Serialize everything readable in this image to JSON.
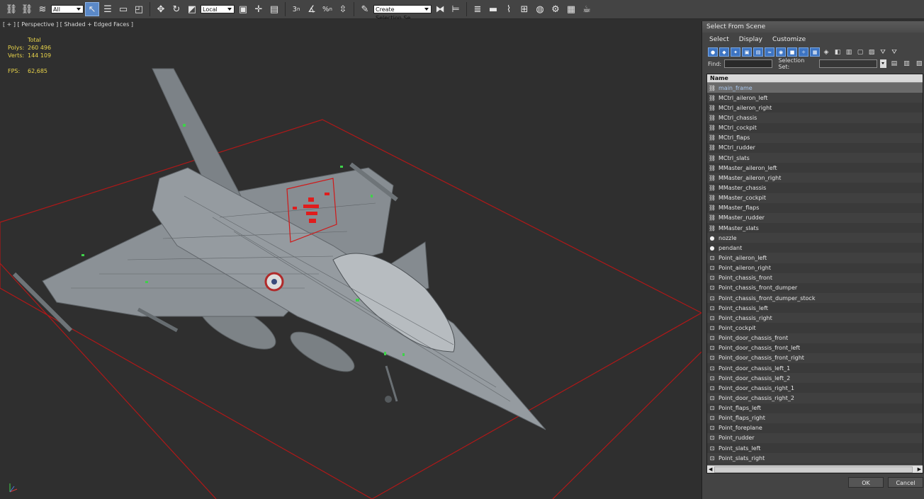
{
  "toolbar": {
    "filter_value": "All",
    "coord_value": "Local",
    "selection_set_value": "Create Selection Se",
    "snap_label_3": "3",
    "snap_label_n": "n",
    "percent_snap": "%",
    "percent_n": "n"
  },
  "viewport": {
    "label": "[ + ] [ Perspective ] [ Shaded + Edged Faces ]",
    "stats": {
      "total_label": "Total",
      "polys_label": "Polys:",
      "polys_value": "260 496",
      "verts_label": "Verts:",
      "verts_value": "144 109",
      "fps_label": "FPS:",
      "fps_value": "62,685"
    }
  },
  "dialog": {
    "title": "Select From Scene",
    "menu": [
      "Select",
      "Display",
      "Customize"
    ],
    "find_label": "Find:",
    "selection_set_label": "Selection Set:",
    "column_name": "Name",
    "items": [
      "main_frame",
      "MCtrl_aileron_left",
      "MCtrl_aileron_right",
      "MCtrl_chassis",
      "MCtrl_cockpit",
      "MCtrl_flaps",
      "MCtrl_rudder",
      "MCtrl_slats",
      "MMaster_aileron_left",
      "MMaster_aileron_right",
      "MMaster_chassis",
      "MMaster_cockpit",
      "MMaster_flaps",
      "MMaster_rudder",
      "MMaster_slats",
      "nozzle",
      "pendant",
      "Point_aileron_left",
      "Point_aileron_right",
      "Point_chassis_front",
      "Point_chassis_front_dumper",
      "Point_chassis_front_dumper_stock",
      "Point_chassis_left",
      "Point_chassis_right",
      "Point_cockpit",
      "Point_door_chassis_front",
      "Point_door_chassis_front_left",
      "Point_door_chassis_front_right",
      "Point_door_chassis_left_1",
      "Point_door_chassis_left_2",
      "Point_door_chassis_right_1",
      "Point_door_chassis_right_2",
      "Point_flaps_left",
      "Point_flaps_right",
      "Point_foreplane",
      "Point_rudder",
      "Point_slats_left",
      "Point_slats_right"
    ],
    "ok_label": "OK",
    "cancel_label": "Cancel"
  },
  "colors": {
    "viewport_bg": "#2f2f2f",
    "panel_bg": "#444444",
    "stats_text": "#e8d34a",
    "accent_blue": "#3d74c2",
    "bbox_red": "#b01818"
  }
}
